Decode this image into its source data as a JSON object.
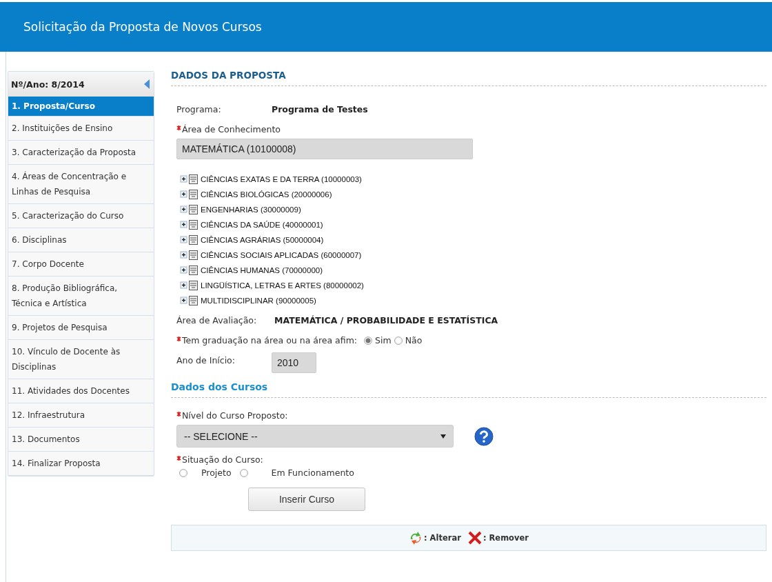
{
  "header": {
    "title": "Solicitação da Proposta de Novos Cursos"
  },
  "sidebar": {
    "heading": "Nº/Ano: 8/2014",
    "items": [
      {
        "label": "1. Proposta/Curso",
        "selected": true
      },
      {
        "label": "2. Instituições de Ensino",
        "selected": false
      },
      {
        "label": "3. Caracterização da Proposta",
        "selected": false
      },
      {
        "label": "4. Áreas de Concentração e Linhas de Pesquisa",
        "selected": false
      },
      {
        "label": "5. Caracterização do Curso",
        "selected": false
      },
      {
        "label": "6. Disciplinas",
        "selected": false
      },
      {
        "label": "7. Corpo Docente",
        "selected": false
      },
      {
        "label": "8. Produção Bibliográfica, Técnica e Artística",
        "selected": false
      },
      {
        "label": "9. Projetos de Pesquisa",
        "selected": false
      },
      {
        "label": "10. Vínculo de Docente às Disciplinas",
        "selected": false
      },
      {
        "label": "11. Atividades dos Docentes",
        "selected": false
      },
      {
        "label": "12. Infraestrutura",
        "selected": false
      },
      {
        "label": "13. Documentos",
        "selected": false
      },
      {
        "label": "14. Finalizar Proposta",
        "selected": false
      }
    ]
  },
  "proposal": {
    "title": "DADOS DA PROPOSTA",
    "program": {
      "label": "Programa:",
      "value": "Programa de Testes"
    },
    "knowledge_area": {
      "label": "Área de Conhecimento",
      "required": true,
      "value": "MATEMÁTICA (10100008)"
    },
    "tree": [
      {
        "label": "CIÊNCIAS EXATAS E DA TERRA (10000003)",
        "expanded": false
      },
      {
        "label": "CIÊNCIAS BIOLÓGICAS (20000006)",
        "expanded": false
      },
      {
        "label": "ENGENHARIAS (30000009)",
        "expanded": false
      },
      {
        "label": "CIÊNCIAS DA SAÚDE (40000001)",
        "expanded": false
      },
      {
        "label": "CIÊNCIAS AGRÁRIAS (50000004)",
        "expanded": false
      },
      {
        "label": "CIÊNCIAS SOCIAIS APLICADAS (60000007)",
        "expanded": false
      },
      {
        "label": "CIÊNCIAS HUMANAS (70000000)",
        "expanded": false
      },
      {
        "label": "LINGÜÍSTICA, LETRAS E ARTES (80000002)",
        "expanded": false
      },
      {
        "label": "MULTIDISCIPLINAR (90000005)",
        "expanded": false
      }
    ],
    "evaluation_area": {
      "label": "Área de Avaliação:",
      "value": "MATEMÁTICA / PROBABILIDADE E ESTATÍSTICA"
    },
    "graduation": {
      "label": "Tem graduação na área ou na área afim:",
      "required": true,
      "options": [
        {
          "label": "Sim",
          "selected": true
        },
        {
          "label": "Não",
          "selected": false
        }
      ]
    },
    "start_year": {
      "label": "Ano de Início:",
      "value": "2010"
    }
  },
  "courses": {
    "title": "Dados dos Cursos",
    "level": {
      "label": "Nível do Curso Proposto:",
      "required": true,
      "value": "-- SELECIONE --"
    },
    "situation": {
      "label": "Situação do Curso:",
      "required": true,
      "options": [
        {
          "label": "Projeto",
          "selected": false
        },
        {
          "label": "Em Funcionamento",
          "selected": false
        }
      ]
    },
    "insert_button": "Inserir Curso",
    "legend": [
      {
        "kind": "edit",
        "label": ": Alterar"
      },
      {
        "kind": "remove",
        "label": ": Remover"
      }
    ]
  }
}
